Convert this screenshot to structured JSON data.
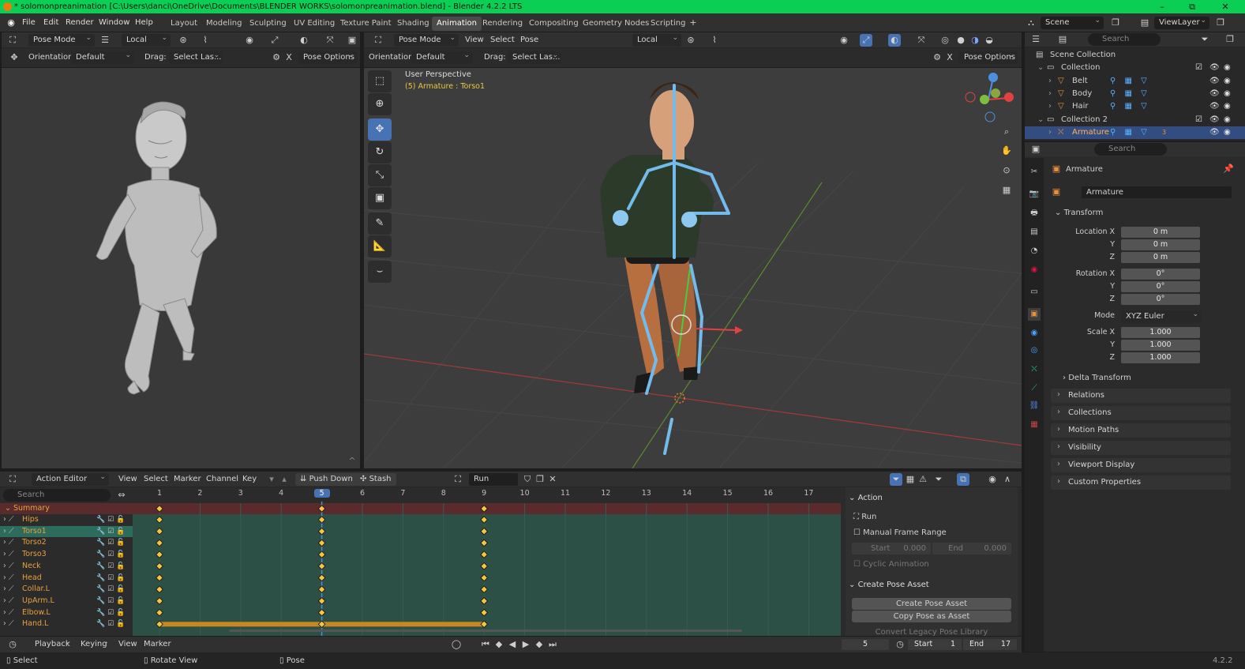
{
  "title_bar": {
    "text": "* solomonpreanimation [C:\\Users\\danci\\OneDrive\\Documents\\BLENDER WORKS\\solomonpreanimation.blend] - Blender 4.2.2 LTS",
    "minimize": "–",
    "maximize": "⧉",
    "close": "✕"
  },
  "menu": [
    "File",
    "Edit",
    "Render",
    "Window",
    "Help"
  ],
  "workspaces": [
    "Layout",
    "Modeling",
    "Sculpting",
    "UV Editing",
    "Texture Paint",
    "Shading",
    "Animation",
    "Rendering",
    "Compositing",
    "Geometry Nodes",
    "Scripting"
  ],
  "active_workspace": "Animation",
  "scene": {
    "scene_label": "Scene",
    "viewlayer_label": "ViewLayer"
  },
  "left_header": {
    "mode": "Pose Mode",
    "transform": "Local",
    "orientation_label": "Orientation:",
    "orientation": "Default",
    "drag_label": "Drag:",
    "drag": "Select Las...",
    "pose_options": "Pose Options"
  },
  "main_header": {
    "mode": "Pose Mode",
    "view": "View",
    "select": "Select",
    "pose": "Pose",
    "transform": "Local",
    "orientation_label": "Orientation:",
    "orientation": "Default",
    "drag_label": "Drag:",
    "drag": "Select Las...",
    "pose_options": "Pose Options"
  },
  "viewport": {
    "perspective": "User Perspective",
    "object_info": "(5) Armature : Torso1"
  },
  "outliner": {
    "search_placeholder": "Search",
    "rows": [
      {
        "label": "Scene Collection",
        "indent": 0,
        "type": "scene"
      },
      {
        "label": "Collection",
        "indent": 1,
        "type": "collection"
      },
      {
        "label": "Belt",
        "indent": 2,
        "type": "mesh"
      },
      {
        "label": "Body",
        "indent": 2,
        "type": "mesh"
      },
      {
        "label": "Hair",
        "indent": 2,
        "type": "mesh"
      },
      {
        "label": "Collection 2",
        "indent": 1,
        "type": "collection"
      },
      {
        "label": "Armature",
        "indent": 2,
        "type": "armature"
      }
    ],
    "armature_badge": "3"
  },
  "properties": {
    "search_placeholder": "Search",
    "object_name": "Armature",
    "datablock": "Armature",
    "transform_title": "Transform",
    "location_label": "Location X",
    "location": [
      "0 m",
      "0 m",
      "0 m"
    ],
    "rotation_label": "Rotation X",
    "rotation": [
      "0°",
      "0°",
      "0°"
    ],
    "mode_label": "Mode",
    "mode": "XYZ Euler",
    "scale_label": "Scale X",
    "scale": [
      "1.000",
      "1.000",
      "1.000"
    ],
    "y_label": "Y",
    "z_label": "Z",
    "delta": "Delta Transform",
    "panels": [
      "Relations",
      "Collections",
      "Motion Paths",
      "Visibility",
      "Viewport Display",
      "Custom Properties"
    ]
  },
  "action_editor": {
    "editor": "Action Editor",
    "menus": [
      "View",
      "Select",
      "Marker",
      "Channel",
      "Key"
    ],
    "push_down": "Push Down",
    "stash": "Stash",
    "action": "Run",
    "search_placeholder": "Search",
    "frames": [
      "1",
      "2",
      "3",
      "4",
      "5",
      "6",
      "7",
      "8",
      "9",
      "10",
      "11",
      "12",
      "13",
      "14",
      "15",
      "16",
      "17"
    ],
    "current_frame": "5",
    "summary": "Summary",
    "channels": [
      "Hips",
      "Torso1",
      "Torso2",
      "Torso3",
      "Neck",
      "Head",
      "Collar.L",
      "UpArm.L",
      "Elbow.L",
      "Hand.L"
    ],
    "keyframes": [
      "1",
      "5",
      "9"
    ],
    "sidebar": {
      "action_title": "Action",
      "action_name": "Run",
      "manual_range": "Manual Frame Range",
      "start_label": "Start",
      "start_val": "0.000",
      "end_label": "End",
      "end_val": "0.000",
      "cyclic": "Cyclic Animation",
      "pose_title": "Create Pose Asset",
      "create_btn": "Create Pose Asset",
      "copy_btn": "Copy Pose as Asset",
      "convert_btn": "Convert Legacy Pose Library"
    }
  },
  "playback": {
    "playback": "Playback",
    "keying": "Keying",
    "view": "View",
    "marker": "Marker",
    "current": "5",
    "start_label": "Start",
    "start": "1",
    "end_label": "End",
    "end": "17"
  },
  "status": {
    "select": "Select",
    "rotate": "Rotate View",
    "pose": "Pose",
    "version": "4.2.2"
  }
}
